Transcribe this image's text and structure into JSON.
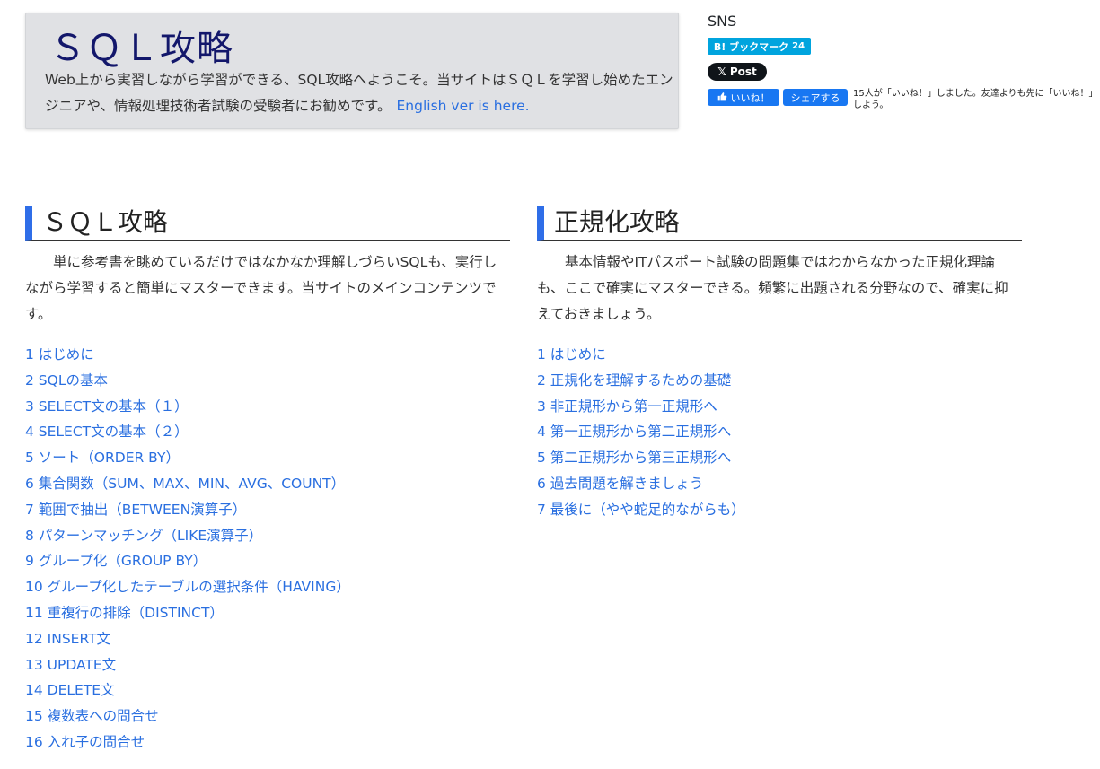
{
  "header": {
    "title": "ＳＱＬ攻略",
    "description": "Web上から実習しながら学習ができる、SQL攻略へようこそ。当サイトはＳＱＬを学習し始めたエンジニアや、情報処理技術者試験の受験者にお勧めです。",
    "english_link": "English ver is here."
  },
  "sns": {
    "title": "SNS",
    "hatena_label": "B! ブックマーク",
    "hatena_count": "24",
    "x_post_label": "Post",
    "fb_like_label": "いいね！",
    "fb_share_label": "シェアする",
    "fb_text": "15人が「いいね！」しました。友達よりも先に「いいね！」しよう。"
  },
  "sections": [
    {
      "title": "ＳＱＬ攻略",
      "description": "単に参考書を眺めているだけではなかなか理解しづらいSQLも、実行しながら学習すると簡単にマスターできます。当サイトのメインコンテンツです。",
      "items": [
        "1 はじめに",
        "2 SQLの基本",
        "3 SELECT文の基本（１）",
        "4 SELECT文の基本（２）",
        "5 ソート（ORDER BY）",
        "6 集合関数（SUM、MAX、MIN、AVG、COUNT）",
        "7 範囲で抽出（BETWEEN演算子）",
        "8 パターンマッチング（LIKE演算子）",
        "9 グループ化（GROUP BY）",
        "10 グループ化したテーブルの選択条件（HAVING）",
        "11 重複行の排除（DISTINCT）",
        "12 INSERT文",
        "13 UPDATE文",
        "14 DELETE文",
        "15 複数表への問合せ",
        "16 入れ子の問合せ"
      ]
    },
    {
      "title": "正規化攻略",
      "description": "基本情報やITパスポート試験の問題集ではわからなかった正規化理論も、ここで確実にマスターできる。頻繁に出題される分野なので、確実に抑えておきましょう。",
      "items": [
        "1 はじめに",
        "2 正規化を理解するための基礎",
        "3 非正規形から第一正規形へ",
        "4 第一正規形から第二正規形へ",
        "5 第二正規形から第三正規形へ",
        "6 過去問題を解きましょう",
        "7 最後に（やや蛇足的ながらも）"
      ]
    }
  ],
  "colors": {
    "link": "#2a6fe0",
    "heading_accent": "#2f6ee8",
    "hero_bg": "#e0e1e4",
    "hero_title": "#13176b",
    "hatena": "#00a4de",
    "facebook": "#1877f2",
    "x": "#0f1419"
  }
}
